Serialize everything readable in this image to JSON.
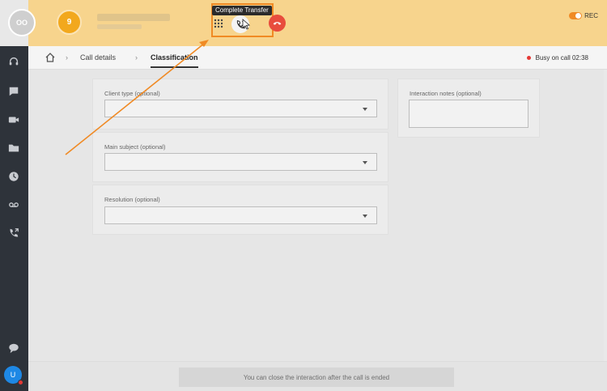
{
  "header": {
    "logo_text": "OO",
    "agent_badge": "9",
    "tooltip": "Complete Transfer",
    "rec_label": "REC"
  },
  "nav": {
    "crumbs": [
      "Call details",
      "Classification"
    ],
    "busy_text": "Busy on call 02:38"
  },
  "form": {
    "client_type_label": "Client type (optional)",
    "main_subject_label": "Main subject (optional)",
    "resolution_label": "Resolution (optional)",
    "notes_label": "Interaction notes (optional)"
  },
  "footer": {
    "close_text": "You can close the interaction after the call is ended"
  },
  "sidebar": {
    "avatar_letter": "U",
    "icons": [
      "headset-icon",
      "chat-icon",
      "video-icon",
      "folder-icon",
      "clock-icon",
      "voicemail-icon",
      "phone-transfer-icon",
      "comment-icon"
    ]
  },
  "colors": {
    "header_bg": "#f7d48d",
    "accent": "#f08a24",
    "hangup": "#e84c3d",
    "sidebar": "#2e333a"
  }
}
